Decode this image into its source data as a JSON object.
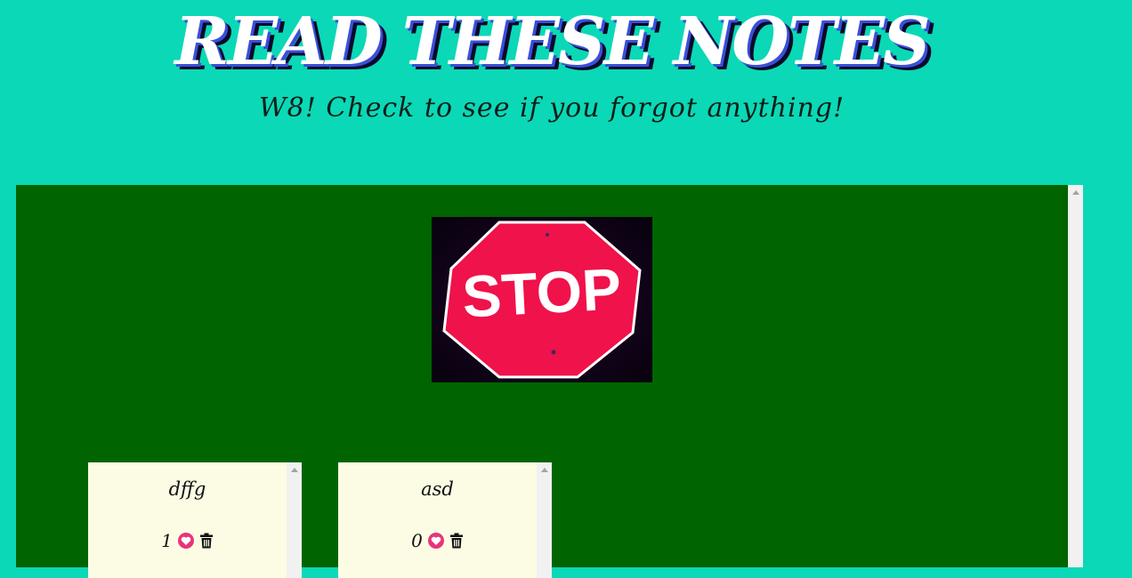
{
  "header": {
    "title": "READ THESE NOTES",
    "subtitle": "W8! Check to see if you forgot anything!"
  },
  "board": {
    "image": {
      "sign_text": "STOP"
    },
    "notes": [
      {
        "title": "dffg",
        "likes": "1"
      },
      {
        "title": "asd",
        "likes": "0"
      }
    ]
  },
  "colors": {
    "background": "#0bd8b6",
    "board": "#006400",
    "note": "#fcfce4",
    "stop_red": "#f0124a",
    "heart": "#e8347a"
  },
  "icons": [
    "heart-icon",
    "trash-icon"
  ]
}
